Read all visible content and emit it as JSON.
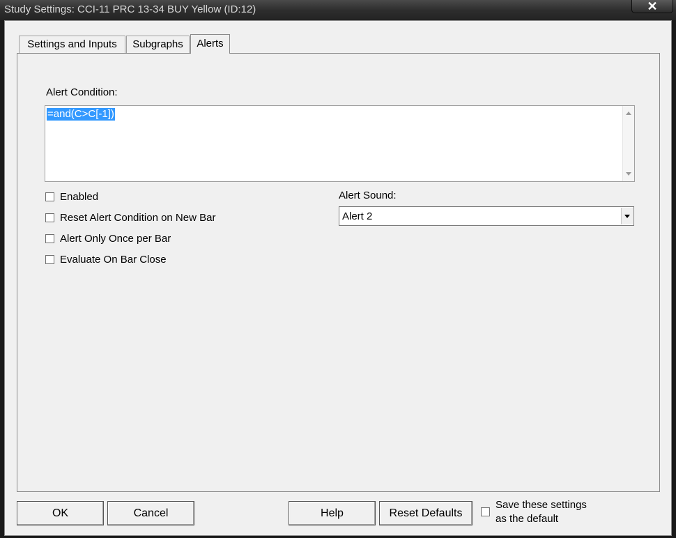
{
  "window": {
    "title": "Study Settings: CCI-11 PRC 13-34 BUY Yellow (ID:12)",
    "close_glyph": "✕"
  },
  "tabs": [
    {
      "label": "Settings and Inputs",
      "active": false
    },
    {
      "label": "Subgraphs",
      "active": false
    },
    {
      "label": "Alerts",
      "active": true
    }
  ],
  "alerts": {
    "condition_label": "Alert Condition:",
    "condition_value": "=and(C>C[-1])",
    "checkboxes": [
      {
        "label": "Enabled",
        "checked": false
      },
      {
        "label": "Reset Alert Condition on New Bar",
        "checked": false
      },
      {
        "label": "Alert Only Once per Bar",
        "checked": false
      },
      {
        "label": "Evaluate On Bar Close",
        "checked": false
      }
    ],
    "sound_label": "Alert Sound:",
    "sound_value": "Alert 2"
  },
  "footer": {
    "ok": "OK",
    "cancel": "Cancel",
    "help": "Help",
    "reset_defaults": "Reset Defaults",
    "save_default_line1": "Save these settings",
    "save_default_line2": "as the default",
    "save_default_checked": false
  },
  "colors": {
    "selection": "#3399ff",
    "dialog_bg": "#f0f0f0",
    "titlebar": "#2e2e2e"
  }
}
